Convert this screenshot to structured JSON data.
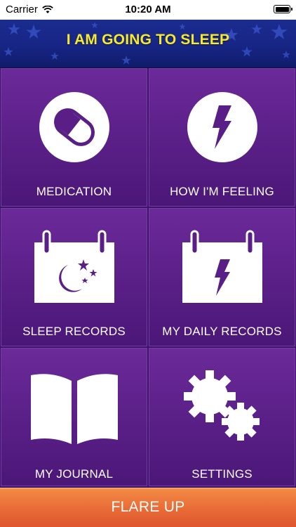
{
  "status_bar": {
    "carrier": "Carrier",
    "time": "10:20 AM"
  },
  "header": {
    "title": "I AM GOING TO SLEEP"
  },
  "tiles": [
    {
      "label": "MEDICATION",
      "icon": "pill-icon"
    },
    {
      "label": "HOW I'M FEELING",
      "icon": "lightning-bolt-icon"
    },
    {
      "label": "SLEEP RECORDS",
      "icon": "calendar-moon-icon"
    },
    {
      "label": "MY DAILY RECORDS",
      "icon": "calendar-bolt-icon"
    },
    {
      "label": "MY JOURNAL",
      "icon": "open-book-icon"
    },
    {
      "label": "SETTINGS",
      "icon": "gears-icon"
    }
  ],
  "flare_button": {
    "label": "FLARE UP"
  },
  "colors": {
    "header_title": "#f6ea2a",
    "header_bg": "#1b2c8f",
    "tile_bg": "#5a1f87",
    "flare_bg": "#e96a36"
  }
}
